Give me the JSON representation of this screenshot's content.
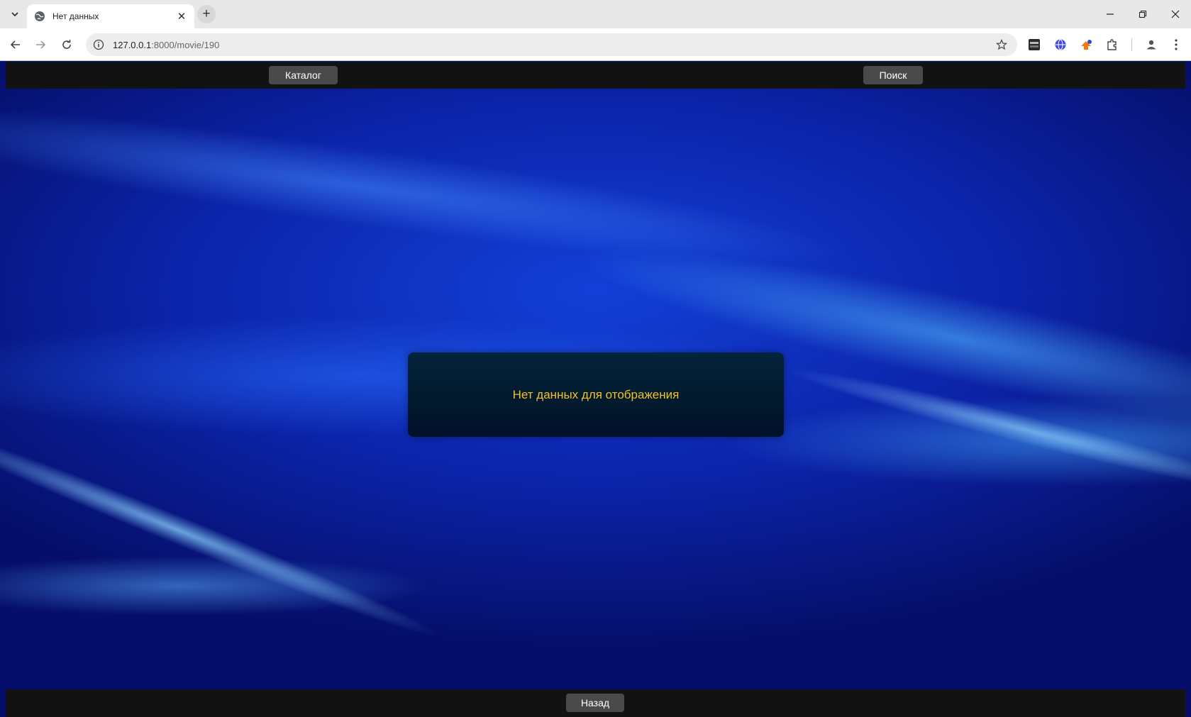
{
  "browser": {
    "tab_title": "Нет данных",
    "url_host": "127.0.0.1",
    "url_rest": ":8000/movie/190",
    "icons": {
      "tab_list": "chevron-down-icon",
      "tab": "globe-icon",
      "tab_close": "close-icon",
      "new_tab": "plus-icon",
      "back": "arrow-left-icon",
      "forward": "arrow-right-icon",
      "reload": "reload-icon",
      "site_info": "info-icon",
      "bookmark": "star-icon",
      "extensions": [
        "cai-extension-icon",
        "translate-globe-icon",
        "orange-extension-icon",
        "puzzle-icon"
      ],
      "profile": "person-icon",
      "menu": "kebab-menu-icon"
    }
  },
  "page": {
    "nav": {
      "catalog_label": "Каталог",
      "search_label": "Поиск"
    },
    "message": "Нет данных для отображения",
    "back_label": "Назад",
    "colors": {
      "bar": "#121212",
      "button": "#4a4a4a",
      "message_text": "#f2c028",
      "message_box": "#021a2e"
    }
  }
}
